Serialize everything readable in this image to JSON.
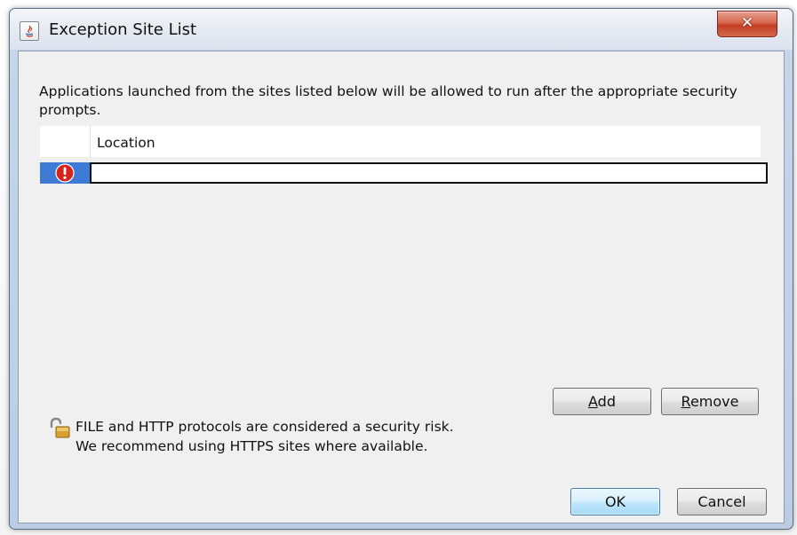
{
  "window": {
    "title": "Exception Site List",
    "close_glyph": "✕",
    "icon": "java-icon"
  },
  "description": "Applications launched from the sites listed below will be allowed to run after the appropriate security prompts.",
  "table": {
    "columns": [
      "Location"
    ],
    "rows": [
      {
        "status_icon": "warning-icon",
        "location": ""
      }
    ]
  },
  "buttons": {
    "add": {
      "accel": "A",
      "rest": "dd"
    },
    "remove": {
      "accel": "R",
      "rest": "emove"
    },
    "ok": "OK",
    "cancel": "Cancel"
  },
  "security_warning": {
    "icon": "unlocked-padlock-icon",
    "line1": "FILE and HTTP protocols are considered a security risk.",
    "line2": "We recommend using HTTPS sites where available."
  },
  "colors": {
    "selection_blue": "#3d7bd6",
    "warning_red": "#d5251b",
    "close_red": "#c43c23",
    "default_button_border": "#3c7fb1"
  }
}
